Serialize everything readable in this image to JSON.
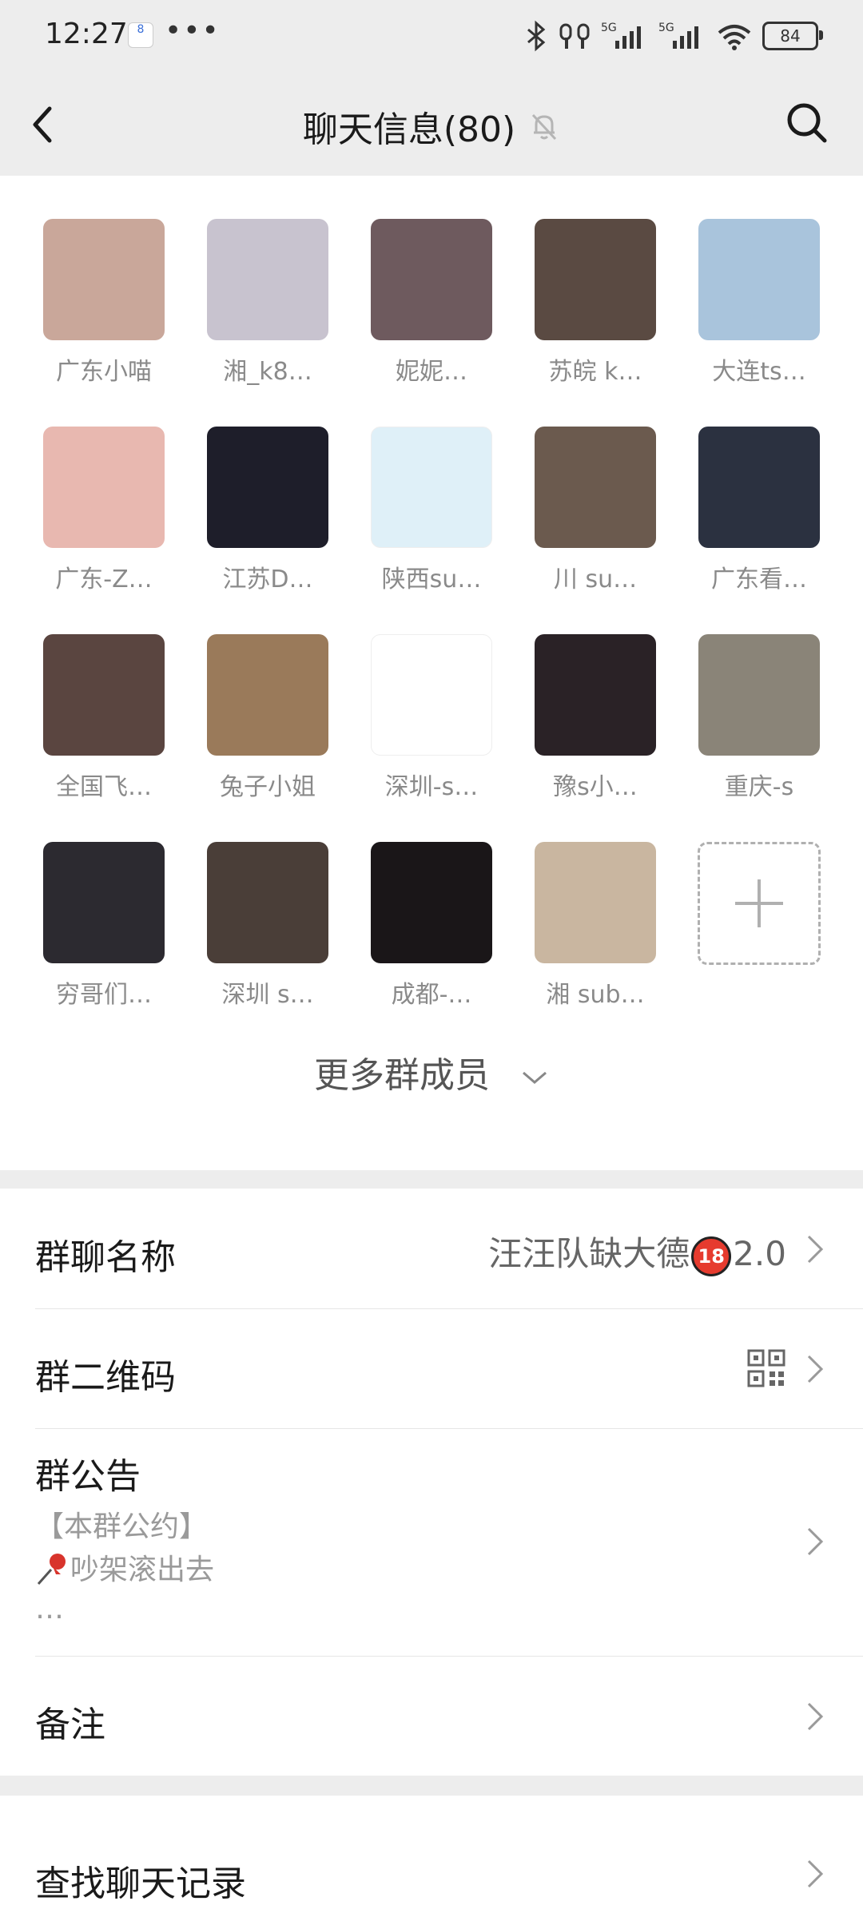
{
  "status_bar": {
    "time": "12:27",
    "notification_badge": "8",
    "more_dots": "•••",
    "battery": "84",
    "network_labels": [
      "5G",
      "5G"
    ],
    "icons": [
      "bluetooth-icon",
      "earbuds-icon",
      "signal-icon",
      "signal-icon",
      "wifi-icon",
      "battery-icon"
    ]
  },
  "nav": {
    "title": "聊天信息(80)",
    "icons": [
      "back-icon",
      "mute-bell-icon",
      "search-icon"
    ]
  },
  "members": [
    {
      "name": "广东小喵",
      "color": "#c9a79a"
    },
    {
      "name": "湘_k8…",
      "color": "#c8c3cf"
    },
    {
      "name": "妮妮…",
      "color": "#6e5a5e"
    },
    {
      "name": "苏皖 k…",
      "color": "#5a4a42"
    },
    {
      "name": "大连ts…",
      "color": "#a9c4dc"
    },
    {
      "name": "广东-Z…",
      "color": "#e8b8b0"
    },
    {
      "name": "江苏D…",
      "color": "#1e1e2a"
    },
    {
      "name": "陕西su…",
      "color": "#dff0f8"
    },
    {
      "name": "川  su…",
      "color": "#6b5a4e"
    },
    {
      "name": "广东看…",
      "color": "#2b3140"
    },
    {
      "name": "全国飞…",
      "color": "#5a4540"
    },
    {
      "name": "兔子小姐",
      "color": "#9a7a5a"
    },
    {
      "name": "深圳-s…",
      "color": "#ffffff"
    },
    {
      "name": "豫s小…",
      "color": "#2a2226"
    },
    {
      "name": "重庆-s",
      "color": "#8a8478"
    },
    {
      "name": "穷哥们…",
      "color": "#2c2a30"
    },
    {
      "name": "深圳 s…",
      "color": "#4a3e38"
    },
    {
      "name": "成都-…",
      "color": "#1a1618"
    },
    {
      "name": "湘 sub…",
      "color": "#c9b6a0"
    }
  ],
  "add_member_icon": "plus-icon",
  "more_members": "更多群成员",
  "rows": {
    "group_name": {
      "label": "群聊名称",
      "value_before": "汪汪队缺大德",
      "badge": "18",
      "value_after": "2.0"
    },
    "qr_code": {
      "label": "群二维码",
      "icon": "qr-code-icon"
    },
    "notice": {
      "label": "群公告",
      "line1": "【本群公约】",
      "line2": "吵架滚出去",
      "line3": "…",
      "pin_icon": "pushpin-icon"
    },
    "remark": {
      "label": "备注"
    },
    "search_history": {
      "label": "查找聊天记录"
    }
  }
}
